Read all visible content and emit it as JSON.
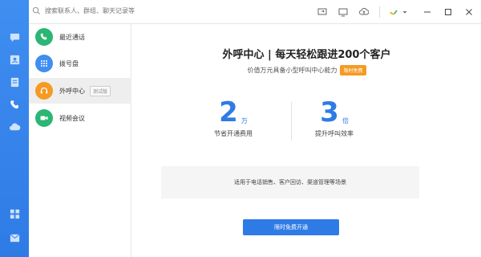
{
  "search": {
    "placeholder": "搜索联系人、群组、聊天记录等"
  },
  "rail": {
    "icons": [
      "chat-icon",
      "contacts-icon",
      "notebook-icon",
      "phone-icon",
      "cloud-icon",
      "apps-grid-icon",
      "mail-icon"
    ]
  },
  "topbar": {
    "icons": [
      "screen-share-icon",
      "monitor-icon",
      "cloud-upload-icon",
      "user-status-icon",
      "dropdown-icon",
      "minimize-icon",
      "maximize-icon",
      "close-icon"
    ]
  },
  "sidebar": {
    "items": [
      {
        "label": "最近通话",
        "icon": "phone-call-icon",
        "color": "#2bb673"
      },
      {
        "label": "拨号盘",
        "icon": "dialpad-icon",
        "color": "#3f8ef0"
      },
      {
        "label": "外呼中心",
        "icon": "headset-icon",
        "color": "#f59a23",
        "badge": "测试版"
      },
      {
        "label": "视频会议",
        "icon": "video-meeting-icon",
        "color": "#2bb673"
      }
    ]
  },
  "main": {
    "headline": "外呼中心 | 每天轻松跟进200个客户",
    "subline": "价值万元具备小型呼叫中心能力",
    "badge": "限时免费",
    "stats": [
      {
        "value": "2",
        "unit": "万",
        "label": "节省开通费用"
      },
      {
        "value": "3",
        "unit": "倍",
        "label": "提升呼叫效率"
      }
    ],
    "note": "适用于电话销售、客户回访、渠道管理等场景",
    "cta": "限时免费开通"
  },
  "colors": {
    "accent": "#2f7be6",
    "orange": "#f59a23",
    "green": "#2bb673"
  }
}
